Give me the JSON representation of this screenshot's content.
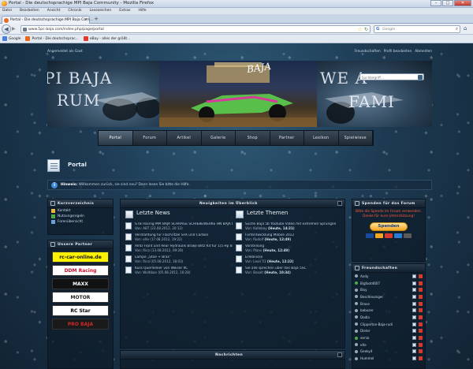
{
  "browser": {
    "window_title": "Portal - Die deutschsprachige MPI Baja Community - Mozilla Firefox",
    "menu": [
      "Datei",
      "Bearbeiten",
      "Ansicht",
      "Chronik",
      "Lesezeichen",
      "Extras",
      "Hilfe"
    ],
    "tab_label": "Portal - Die deutschsprachige MPI Baja Com...",
    "url": "www.5pc-baja.com/index.php/page/portal",
    "search_placeholder": "Google",
    "search_engine_glyph": "G",
    "bookmarks": [
      {
        "label": "Google",
        "color": "#4a7fe0"
      },
      {
        "label": "Portal - Die deutschsprac...",
        "color": "#e66a1f"
      },
      {
        "label": "eBay - alles der größt...",
        "color": "#e23a2e"
      }
    ]
  },
  "site": {
    "top_left": "Angemeldet als Gast",
    "top_right": [
      "Freundschaften",
      "Profil bearbeiten",
      "Abmelden"
    ],
    "banner_left_text": "PI BAJA\nRUM",
    "banner_right_text": "WE A\nFAMI",
    "banner_logo": "BAJA",
    "banner_search_placeholder": "Suchbegriff...",
    "nav": [
      "Portal",
      "Forum",
      "Artikel",
      "Galerie",
      "Shop",
      "Partner",
      "Lexikon",
      "Spielwiese"
    ],
    "page_title": "Portal",
    "welcome_text": "Willkommen zurück, sie sind neu? Dann lesen Sie bitte die Hilfe.",
    "welcome_bold": "Hinweis:"
  },
  "shortcuts": {
    "title": "Kurzverzeichnis",
    "items": [
      {
        "label": "Kontakt",
        "color": "#f0b73a"
      },
      {
        "label": "Nutzungsregeln",
        "color": "#4caa4c"
      },
      {
        "label": "Forenübersicht",
        "color": "#6aa0d8"
      }
    ]
  },
  "partners": {
    "title": "Unsere Partner",
    "logos": [
      {
        "label": "rc-car-online.de",
        "bg": "#fff200",
        "color": "#111"
      },
      {
        "label": "DDM Racing",
        "bg": "#ffffff",
        "color": "#c8102e"
      },
      {
        "label": "MAXX",
        "bg": "#111111",
        "color": "#ffffff"
      },
      {
        "label": "MOTOR",
        "bg": "#ffffff",
        "color": "#222222"
      },
      {
        "label": "RC Star",
        "bg": "#ffffff",
        "color": "#000000"
      },
      {
        "label": "PRO BAJA",
        "bg": "#1a1a1a",
        "color": "#cc2a2a"
      }
    ]
  },
  "news": {
    "title": "Neuigkeiten im Überblick",
    "col1_title": "Letzte News",
    "col1_items": [
      {
        "title": "GTB Racing MPI BAJA SCHRÄGE SCHIEBEWERKE HN BAJA BUGGY BE...",
        "meta": "Von: ABT (23.08.2012, 20:12)"
      },
      {
        "title": "Verdrahtung für Flachritzel SFK und Carbon",
        "meta": "Von: eXe (17.08.2012, 19:22)"
      },
      {
        "title": "AVID Front und Rear Hydraulik Brake Blitz Kit für 1/5 Hp Baja",
        "meta": "Von: Rico (13.08.2012, 09:28)"
      },
      {
        "title": "Lampe „Stoe + Bras\"",
        "meta": "Von: Rico (05.08.2012, 18:03)"
      },
      {
        "title": "Kuss Querlenker von Weiser RC",
        "meta": "Von: Woltiban (05.08.2012, 16:28)"
      }
    ],
    "col2_title": "Letzte Themen",
    "col2_items": [
      {
        "title": "Suche Baja 5b Youtube Video mit extremen Sprüngen",
        "meta": "Von: Kalleboy",
        "tail": "(Heute, 14:31)"
      },
      {
        "title": "Fortentwicklung Mobile 2012",
        "meta": "Von: Rudolf",
        "tail": "(Heute, 12:49)"
      },
      {
        "title": "Vorstellung",
        "meta": "Von: Plaxx",
        "tail": "(Heute, 12:49)"
      },
      {
        "title": "Erlebnisse",
        "meta": "Von: Leon 51",
        "tail": "(Heute, 12:22)"
      },
      {
        "title": "Sie alle sprechen über das Baja 5SC",
        "meta": "Von: Basalt",
        "tail": "(Heute, 10:34)"
      }
    ]
  },
  "news_bar": {
    "title": "Nachrichten"
  },
  "donate": {
    "title": "Spenden für das Forum",
    "text": "Bitte die Spende im Forum verwenden. Danke für eure Unterstützung!",
    "button": "Spenden",
    "cards": [
      "#1a4aa0",
      "#f5a623",
      "#d63a2e",
      "#2a7ad6",
      "#5a5a5a"
    ]
  },
  "friends": {
    "title": "Freundschaften",
    "list": [
      {
        "name": "Andy",
        "status": "#9aa8b6"
      },
      {
        "name": "Bigfoot4607",
        "status": "#4caa4c"
      },
      {
        "name": "Bisy",
        "status": "#9aa8b6"
      },
      {
        "name": "Beschleuniger",
        "status": "#9aa8b6"
      },
      {
        "name": "Bravo",
        "status": "#9aa8b6"
      },
      {
        "name": "babuzer",
        "status": "#9aa8b6"
      },
      {
        "name": "Dodla",
        "status": "#9aa8b6"
      },
      {
        "name": "Clipperton-Baja-rudi",
        "status": "#9aa8b6"
      },
      {
        "name": "Dieter",
        "status": "#9aa8b6"
      },
      {
        "name": "ennio",
        "status": "#4caa4c"
      },
      {
        "name": "eXe",
        "status": "#9aa8b6"
      },
      {
        "name": "Geeky4",
        "status": "#9aa8b6"
      },
      {
        "name": "Hummel",
        "status": "#9aa8b6"
      }
    ]
  },
  "colors": {
    "accent": "#2d4b66",
    "background": "#1d3a52"
  }
}
